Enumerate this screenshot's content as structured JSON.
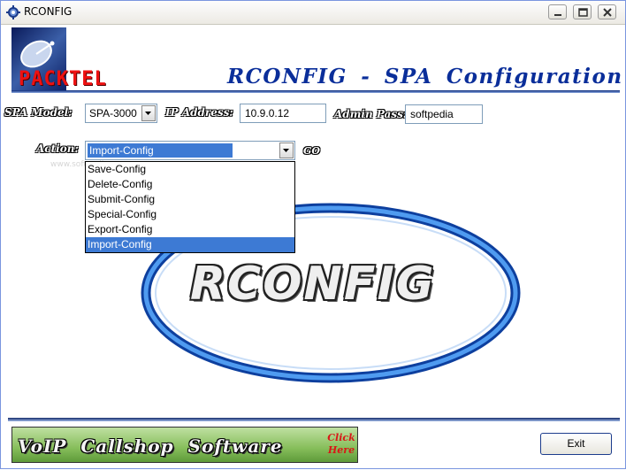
{
  "window": {
    "title": "RCONFIG",
    "controls": [
      "minimize",
      "maximize",
      "close"
    ]
  },
  "header": {
    "logo_text": "PACKTEL",
    "app_heading": "RCONFIG  -  SPA  Configuration"
  },
  "form": {
    "spa_model_label": "SPA Model:",
    "spa_model_value": "SPA-3000",
    "ip_address_label": "IP Address:",
    "ip_address_value": "10.9.0.12",
    "admin_pass_label": "Admin Pass:",
    "admin_pass_value": "softpedia",
    "action_label": "Action:",
    "action_value": "Import-Config",
    "go_label": "GO"
  },
  "action_options": [
    "Save-Config",
    "Delete-Config",
    "Submit-Config",
    "Special-Config",
    "Export-Config",
    "Import-Config"
  ],
  "selected_action_index": 5,
  "watermark": "www.softpedia.com",
  "center_logo": {
    "text": "RCONFIG"
  },
  "footer": {
    "banner_text": "VoIP  Callshop  Software",
    "click_line1": "Click",
    "click_line2": "Here",
    "exit_label": "Exit"
  },
  "colors": {
    "heading_blue": "#0a2e9a",
    "logo_red": "#ee1111",
    "selection_blue": "#3d7ad4",
    "oval_blue": "#1e6fd6",
    "banner_green": "#86be5a",
    "click_red": "#d81818"
  }
}
